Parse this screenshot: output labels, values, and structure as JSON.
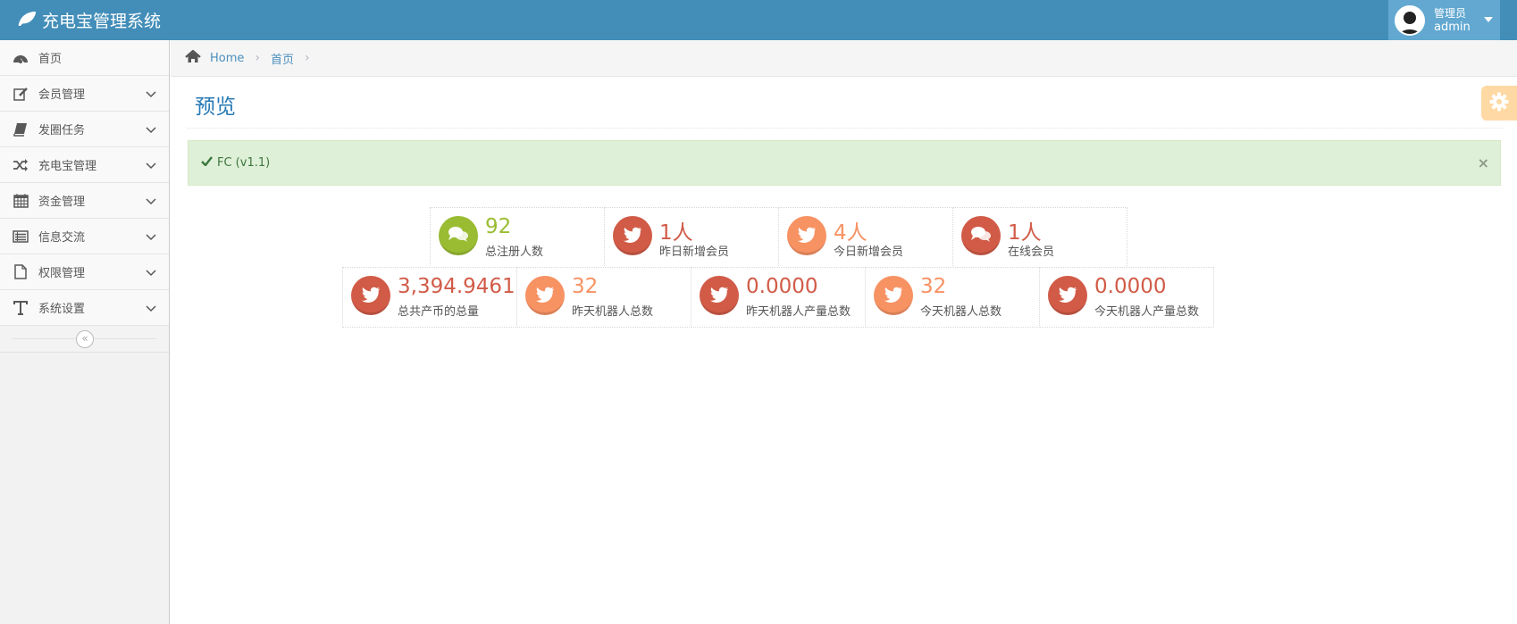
{
  "app": {
    "title": "充电宝管理系统"
  },
  "user": {
    "role": "管理员",
    "name": "admin"
  },
  "sidebar": {
    "items": [
      {
        "label": "首页",
        "icon": "dashboard-icon"
      },
      {
        "label": "会员管理",
        "icon": "edit-icon"
      },
      {
        "label": "发圈任务",
        "icon": "book-icon"
      },
      {
        "label": "充电宝管理",
        "icon": "random-icon"
      },
      {
        "label": "资金管理",
        "icon": "calendar-icon"
      },
      {
        "label": "信息交流",
        "icon": "list-icon"
      },
      {
        "label": "权限管理",
        "icon": "file-icon"
      },
      {
        "label": "系统设置",
        "icon": "text-icon"
      }
    ],
    "collapse_symbol": "«"
  },
  "breadcrumb": {
    "items": [
      "Home",
      "首页"
    ]
  },
  "page": {
    "title": "预览"
  },
  "alert": {
    "text": "FC (v1.1)",
    "close": "×"
  },
  "stats": [
    {
      "value": "92",
      "label": "总注册人数",
      "color": "#9abc32",
      "icon": "comments-icon"
    },
    {
      "value": "1人",
      "label": "昨日新增会员",
      "color": "#d15b47",
      "icon": "twitter-icon"
    },
    {
      "value": "4人",
      "label": "今日新增会员",
      "color": "#f79263",
      "icon": "twitter-icon"
    },
    {
      "value": "1人",
      "label": "在线会员",
      "color": "#d15b47",
      "icon": "comments-icon"
    },
    {
      "value": "3,394.9461",
      "label": "总共产币的总量",
      "color": "#d15b47",
      "icon": "twitter-icon"
    },
    {
      "value": "32",
      "label": "昨天机器人总数",
      "color": "#f79263",
      "icon": "twitter-icon"
    },
    {
      "value": "0.0000",
      "label": "昨天机器人产量总数",
      "color": "#d15b47",
      "icon": "twitter-icon"
    },
    {
      "value": "32",
      "label": "今天机器人总数",
      "color": "#f79263",
      "icon": "twitter-icon"
    },
    {
      "value": "0.0000",
      "label": "今天机器人产量总数",
      "color": "#d15b47",
      "icon": "twitter-icon"
    }
  ]
}
